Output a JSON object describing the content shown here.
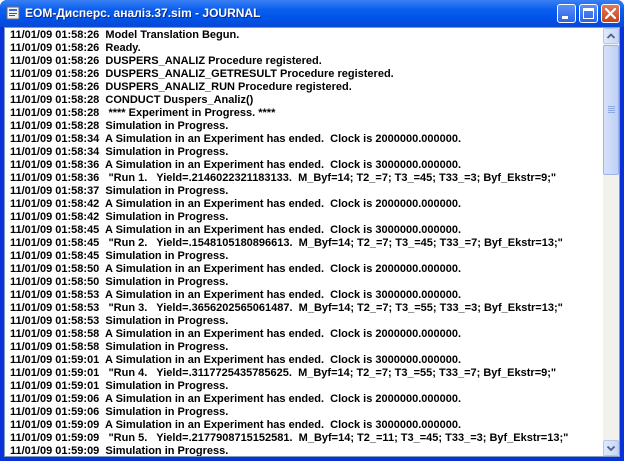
{
  "window": {
    "title": "EOM-Дисперс. аналіз.37.sim  -  JOURNAL",
    "icon": "sim-app-icon",
    "buttons": [
      "minimize-icon",
      "maximize-icon",
      "close-icon"
    ]
  },
  "log": [
    "11/01/09 01:58:26  Model Translation Begun.",
    "11/01/09 01:58:26  Ready.",
    "11/01/09 01:58:26  DUSPERS_ANALIZ Procedure registered.",
    "11/01/09 01:58:26  DUSPERS_ANALIZ_GETRESULT Procedure registered.",
    "11/01/09 01:58:26  DUSPERS_ANALIZ_RUN Procedure registered.",
    "11/01/09 01:58:28  CONDUCT Duspers_Analiz()",
    "11/01/09 01:58:28   **** Experiment in Progress. ****",
    "11/01/09 01:58:28  Simulation in Progress.",
    "11/01/09 01:58:34  A Simulation in an Experiment has ended.  Clock is 2000000.000000.",
    "11/01/09 01:58:34  Simulation in Progress.",
    "11/01/09 01:58:36  A Simulation in an Experiment has ended.  Clock is 3000000.000000.",
    "11/01/09 01:58:36   \"Run 1.   Yield=.2146022321183133.  M_Byf=14; T2_=7; T3_=45; T33_=3; Byf_Ekstr=9;\"",
    "11/01/09 01:58:37  Simulation in Progress.",
    "11/01/09 01:58:42  A Simulation in an Experiment has ended.  Clock is 2000000.000000.",
    "11/01/09 01:58:42  Simulation in Progress.",
    "11/01/09 01:58:45  A Simulation in an Experiment has ended.  Clock is 3000000.000000.",
    "11/01/09 01:58:45   \"Run 2.   Yield=.1548105180896613.  M_Byf=14; T2_=7; T3_=45; T33_=7; Byf_Ekstr=13;\"",
    "11/01/09 01:58:45  Simulation in Progress.",
    "11/01/09 01:58:50  A Simulation in an Experiment has ended.  Clock is 2000000.000000.",
    "11/01/09 01:58:50  Simulation in Progress.",
    "11/01/09 01:58:53  A Simulation in an Experiment has ended.  Clock is 3000000.000000.",
    "11/01/09 01:58:53   \"Run 3.   Yield=.3656202565061487.  M_Byf=14; T2_=7; T3_=55; T33_=3; Byf_Ekstr=13;\"",
    "11/01/09 01:58:53  Simulation in Progress.",
    "11/01/09 01:58:58  A Simulation in an Experiment has ended.  Clock is 2000000.000000.",
    "11/01/09 01:58:58  Simulation in Progress.",
    "11/01/09 01:59:01  A Simulation in an Experiment has ended.  Clock is 3000000.000000.",
    "11/01/09 01:59:01   \"Run 4.   Yield=.3117725435785625.  M_Byf=14; T2_=7; T3_=55; T33_=7; Byf_Ekstr=9;\"",
    "11/01/09 01:59:01  Simulation in Progress.",
    "11/01/09 01:59:06  A Simulation in an Experiment has ended.  Clock is 2000000.000000.",
    "11/01/09 01:59:06  Simulation in Progress.",
    "11/01/09 01:59:09  A Simulation in an Experiment has ended.  Clock is 3000000.000000.",
    "11/01/09 01:59:09   \"Run 5.   Yield=.2177908715152581.  M_Byf=14; T2_=11; T3_=45; T33_=3; Byf_Ekstr=13;\"",
    "11/01/09 01:59:09  Simulation in Progress."
  ],
  "colors": {
    "titlebar": "#0a5ff0",
    "text": "#000000",
    "background": "#ffffff"
  }
}
